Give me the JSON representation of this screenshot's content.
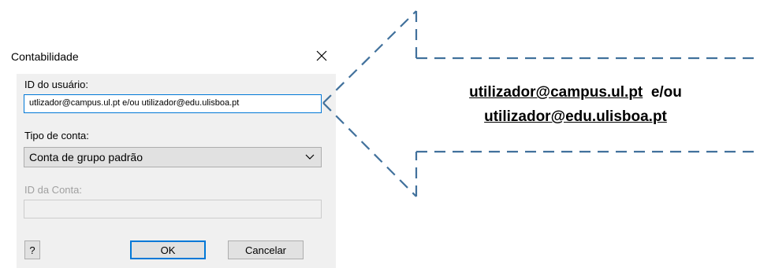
{
  "dialog": {
    "title": "Contabilidade",
    "close_icon": "close-icon",
    "user_id_label": "ID do usuário:",
    "user_id_value": "utlizador@campus.ul.pt e/ou utilizador@edu.ulisboa.pt",
    "account_type_label": "Tipo de conta:",
    "account_type_value": "Conta de grupo padrão",
    "account_id_label": "ID da Conta:",
    "account_id_value": "",
    "help_label": "?",
    "ok_label": "OK",
    "cancel_label": "Cancelar"
  },
  "callout": {
    "email_1": "utilizador@campus.ul.pt",
    "conjunction": "e/ou",
    "email_2": "utilizador@edu.ulisboa.pt",
    "line_color": "#41719c"
  },
  "colors": {
    "focus_border": "#0078d7",
    "dialog_client": "#f0f0f0"
  }
}
